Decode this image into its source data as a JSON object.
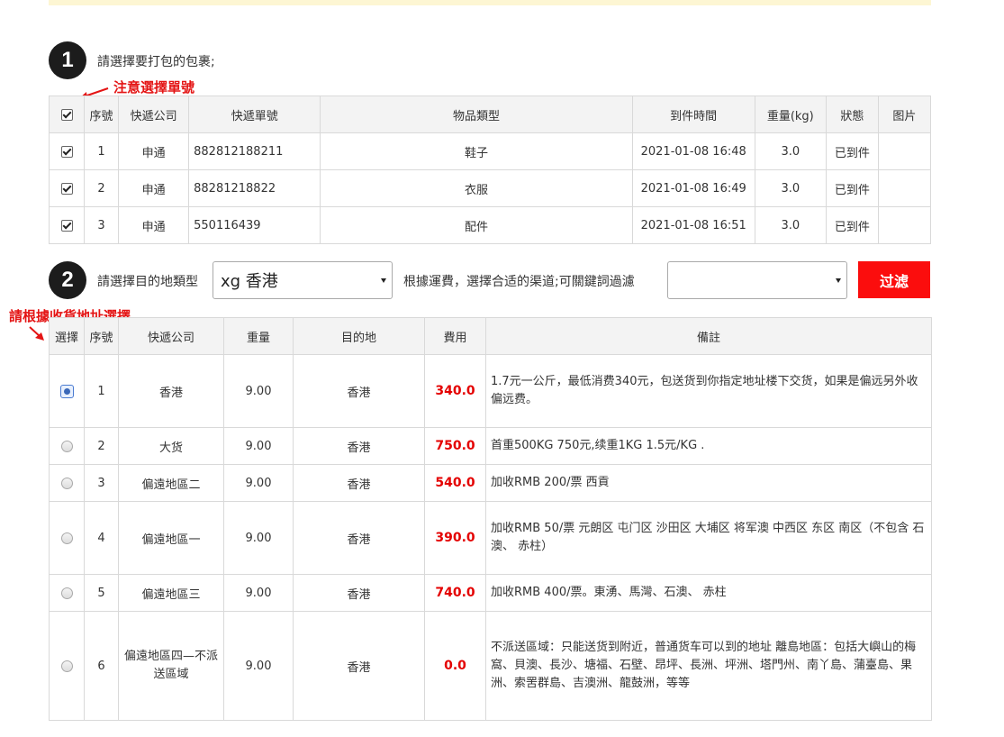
{
  "step1": {
    "number": "1",
    "label": "請選擇要打包的包裹;",
    "annotation": "注意選擇單號",
    "columns": [
      "",
      "序號",
      "快遞公司",
      "快遞單號",
      "物品類型",
      "到件時間",
      "重量(kg)",
      "狀態",
      "图片"
    ],
    "header_checkbox_checked": true,
    "rows": [
      {
        "checked": true,
        "index": "1",
        "company": "申通",
        "tracking": "882812188211",
        "type": "鞋子",
        "arrival": "2021-01-08 16:48",
        "weight": "3.0",
        "status": "已到件",
        "image": ""
      },
      {
        "checked": true,
        "index": "2",
        "company": "申通",
        "tracking": "88281218822",
        "type": "衣服",
        "arrival": "2021-01-08 16:49",
        "weight": "3.0",
        "status": "已到件",
        "image": ""
      },
      {
        "checked": true,
        "index": "3",
        "company": "申通",
        "tracking": "550116439",
        "type": "配件",
        "arrival": "2021-01-08 16:51",
        "weight": "3.0",
        "status": "已到件",
        "image": ""
      }
    ]
  },
  "step2": {
    "number": "2",
    "label": "請選擇目的地類型",
    "destination_select": "xg 香港",
    "filter_label": "根據運費，選擇合适的渠道;可關鍵詞過濾",
    "keyword_select": "",
    "filter_button": "过滤",
    "annotation": "請根據收貨地址選擇",
    "columns": [
      "選擇",
      "序號",
      "快遞公司",
      "重量",
      "目的地",
      "費用",
      "備註"
    ],
    "rows": [
      {
        "selected": true,
        "index": "1",
        "company": "香港",
        "weight": "9.00",
        "dest": "香港",
        "fee": "340.0",
        "note": "1.7元一公斤，最低消费340元，包送货到你指定地址楼下交货，如果是偏远另外收偏远费。"
      },
      {
        "selected": false,
        "index": "2",
        "company": "大货",
        "weight": "9.00",
        "dest": "香港",
        "fee": "750.0",
        "note": "首重500KG 750元,续重1KG 1.5元/KG ."
      },
      {
        "selected": false,
        "index": "3",
        "company": "偏遠地區二",
        "weight": "9.00",
        "dest": "香港",
        "fee": "540.0",
        "note": "加收RMB 200/票 西貢"
      },
      {
        "selected": false,
        "index": "4",
        "company": "偏遠地區一",
        "weight": "9.00",
        "dest": "香港",
        "fee": "390.0",
        "note": "加收RMB 50/票 元朗区 屯门区 沙田区 大埔区 将军澳 中西区 东区 南区（不包含 石澳、 赤柱）"
      },
      {
        "selected": false,
        "index": "5",
        "company": "偏遠地區三",
        "weight": "9.00",
        "dest": "香港",
        "fee": "740.0",
        "note": "加收RMB 400/票。東湧、馬灣、石澳、 赤柱"
      },
      {
        "selected": false,
        "index": "6",
        "company": "偏遠地區四—不派送區域",
        "weight": "9.00",
        "dest": "香港",
        "fee": "0.0",
        "note": "不派送區域：只能送货到附近，普通货车可以到的地址 離島地區：包括大嶼山的梅窩、貝澳、長沙、塘福、石壁、昂坪、長洲、坪洲、塔門州、南丫島、蒲臺島、果洲、索罟群島、吉澳洲、龍鼓洲，等等"
      }
    ]
  }
}
